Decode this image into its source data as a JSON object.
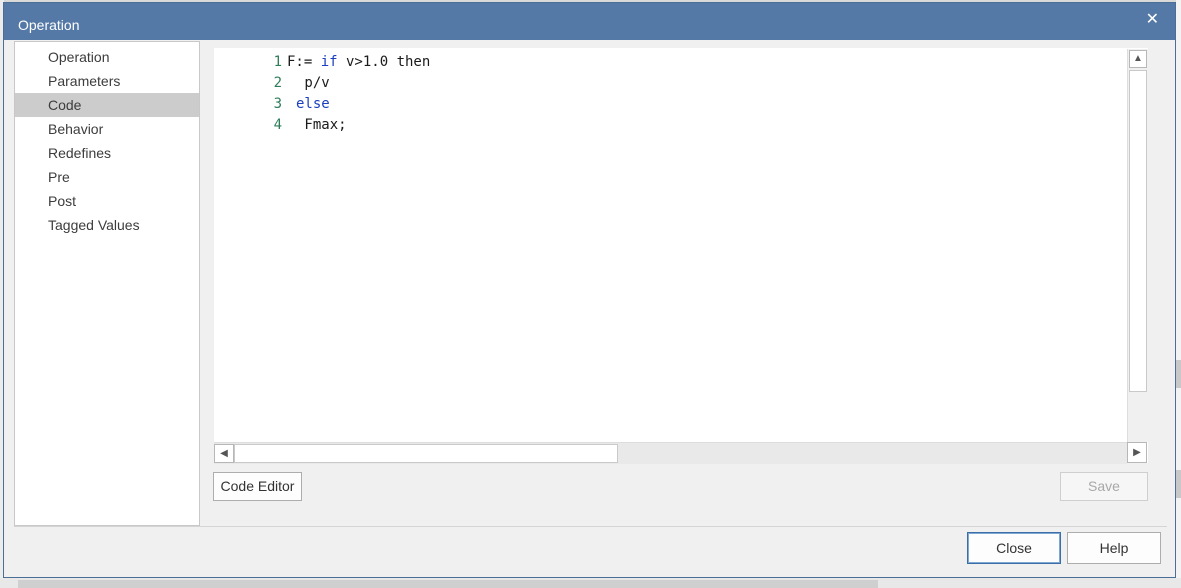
{
  "window": {
    "title": "Operation",
    "close_glyph": "✕"
  },
  "nav": {
    "items": [
      {
        "label": "Operation"
      },
      {
        "label": "Parameters"
      },
      {
        "label": "Code",
        "selected": true
      },
      {
        "label": "Behavior"
      },
      {
        "label": "Redefines"
      },
      {
        "label": "Pre"
      },
      {
        "label": "Post"
      },
      {
        "label": "Tagged Values"
      }
    ]
  },
  "editor": {
    "lines": [
      {
        "num": "1",
        "parts": [
          {
            "t": "F:= ",
            "k": false
          },
          {
            "t": "if",
            "k": true
          },
          {
            "t": " v>1.0 then",
            "k": false
          }
        ]
      },
      {
        "num": "2",
        "parts": [
          {
            "t": " p/v",
            "k": false
          }
        ]
      },
      {
        "num": "3",
        "parts": [
          {
            "t": "else",
            "k": true
          }
        ]
      },
      {
        "num": "4",
        "parts": [
          {
            "t": " Fmax;",
            "k": false
          }
        ]
      }
    ],
    "scroll_up_glyph": "▲",
    "scroll_left_glyph": "◀",
    "scroll_right_glyph": "▶"
  },
  "buttons": {
    "code_editor": "Code Editor",
    "save": "Save",
    "close": "Close",
    "help": "Help"
  },
  "colors": {
    "titlebar": "#5479a6",
    "keyword": "#1b3fbf",
    "line_number": "#2e7d5a",
    "nav_selected": "#cccccc"
  },
  "icons": {
    "close": "close-icon",
    "scroll_up": "arrow-up-icon",
    "scroll_left": "arrow-left-icon",
    "scroll_right": "arrow-right-icon"
  }
}
